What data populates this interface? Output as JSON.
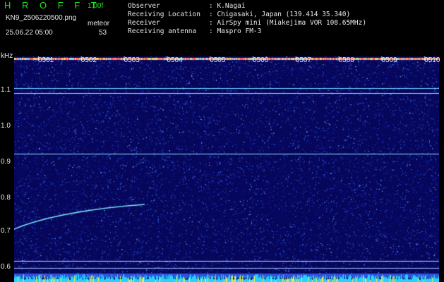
{
  "header": {
    "title": "H R O F F T",
    "version": "1.00f",
    "filename": "KN9_2506220500.png",
    "label": "meteor",
    "datetime": "25.06.22 05:00",
    "count": "53",
    "observer_label": "Observer",
    "observer_value": ": K.Nagai",
    "location_label": "Receiving Location",
    "location_value": ": Chigasaki, Japan (139.414 35.340)",
    "receiver_label": "Receiver",
    "receiver_value": ": AirSpy mini (Miakejima VOR 108.65MHz)",
    "antenna_label": "Receiving antenna",
    "antenna_value": ": Maspro FM-3"
  },
  "spectrogram": {
    "unit": "kHz",
    "time_ticks": [
      "0501",
      "0502",
      "0503",
      "0504",
      "0505",
      "0506",
      "0507",
      "0508",
      "0509",
      "0510"
    ],
    "y_ticks": [
      "1.1",
      "1.0",
      "0.9",
      "0.8",
      "0.7",
      "0.6"
    ],
    "colors": {
      "background": "#0a0a6e",
      "noise": "#2a58c8",
      "signal": "#7fe6ff",
      "bottom": "#23d4ff"
    }
  }
}
